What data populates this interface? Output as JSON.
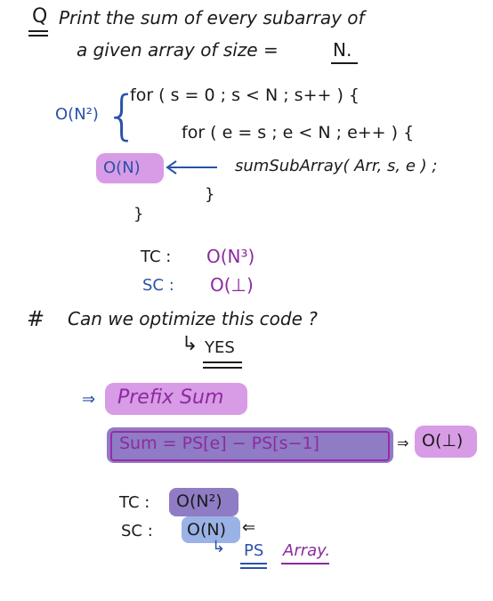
{
  "question": {
    "marker": "Q",
    "line1": "Print the sum of every subarray of",
    "line2_prefix": "a given array of size =",
    "line2_var": "N."
  },
  "brute_force": {
    "outer_complexity": "O(N²)",
    "outer_loop": "for ( s = 0 ;  s < N ;  s++ ) {",
    "inner_loop": "for ( e = s ;  e < N ;  e++ ) {",
    "inner_complexity": "O(N)",
    "call": "sumSubArray( Arr, s, e ) ;",
    "close_inner": "}",
    "close_outer": "}"
  },
  "complexity_1": {
    "tc_label": "TC :",
    "tc_value": "O(N³)",
    "sc_label": "SC :",
    "sc_value": "O(⊥)"
  },
  "optimize": {
    "hash": "#",
    "question": "Can we optimize this code ?",
    "answer_arrow": "↳",
    "answer": "YES"
  },
  "prefix": {
    "arrow": "⇒",
    "title": "Prefix Sum",
    "formula": "Sum  =  PS[e]  −  PS[s−1]",
    "implies": "⇒",
    "formula_complexity": "O(⊥)"
  },
  "complexity_2": {
    "tc_label": "TC :",
    "tc_value": "O(N²)",
    "sc_label": "SC :",
    "sc_value": "O(N)",
    "sc_arrow": "⇐",
    "note_arrow": "↳",
    "note_ps": "PS",
    "note_array": "Array."
  }
}
